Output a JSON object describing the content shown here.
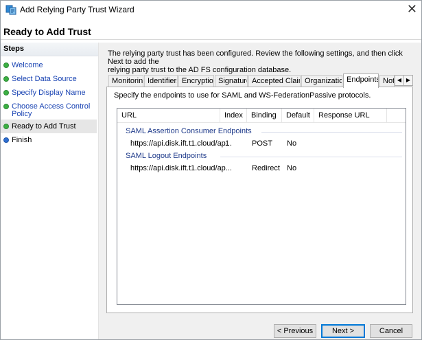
{
  "window": {
    "title": "Add Relying Party Trust Wizard",
    "close_glyph": "✕"
  },
  "page": {
    "title": "Ready to Add Trust"
  },
  "steps": {
    "header": "Steps",
    "items": [
      {
        "label": "Welcome",
        "state": "completed"
      },
      {
        "label": "Select Data Source",
        "state": "completed"
      },
      {
        "label": "Specify Display Name",
        "state": "completed"
      },
      {
        "label": "Choose Access Control Policy",
        "label_line1": "Choose Access Control",
        "label_line2": "Policy",
        "state": "completed"
      },
      {
        "label": "Ready to Add Trust",
        "state": "current"
      },
      {
        "label": "Finish",
        "state": "pending"
      }
    ]
  },
  "main": {
    "intro_line1": "The relying party trust has been configured. Review the following settings, and then click  Next to add the",
    "intro_line2": "relying party trust to the AD FS configuration database."
  },
  "tabs": {
    "items": [
      "Monitoring",
      "Identifiers",
      "Encryption",
      "Signature",
      "Accepted Claims",
      "Organization",
      "Endpoints",
      "Note"
    ],
    "active": "Endpoints",
    "scroll_left": "◀",
    "scroll_right": "▶"
  },
  "endpoints": {
    "description": "Specify the endpoints to use for SAML and WS-FederationPassive protocols.",
    "columns": [
      "URL",
      "Index",
      "Binding",
      "Default",
      "Response URL"
    ],
    "groups": [
      {
        "title": "SAML Assertion Consumer Endpoints",
        "rows": [
          {
            "url": "https://api.disk.ift.t1.cloud/ap...",
            "index": "1",
            "binding": "POST",
            "default": "No",
            "response_url": ""
          }
        ]
      },
      {
        "title": "SAML Logout Endpoints",
        "rows": [
          {
            "url": "https://api.disk.ift.t1.cloud/ap...",
            "index": "",
            "binding": "Redirect",
            "default": "No",
            "response_url": ""
          }
        ]
      }
    ]
  },
  "buttons": {
    "previous": "< Previous",
    "next": "Next >",
    "cancel": "Cancel"
  },
  "colors": {
    "accent": "#0078d7",
    "step_link": "#1a44b3",
    "step_done": "#3cb043",
    "step_pending": "#2f6fd1",
    "group_header": "#1e3a8a"
  }
}
